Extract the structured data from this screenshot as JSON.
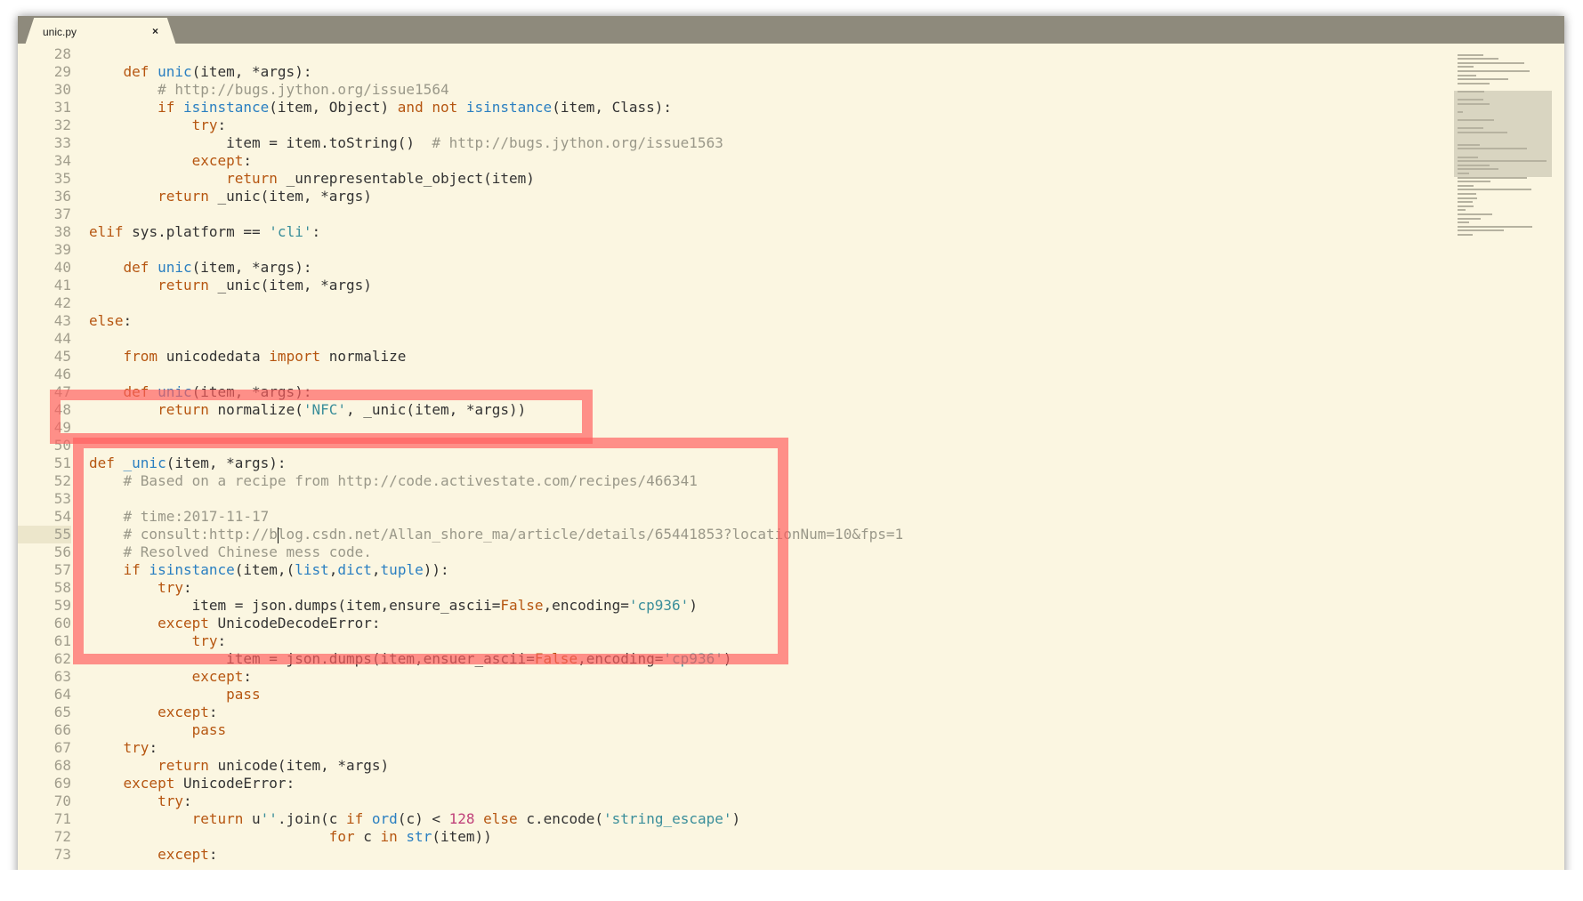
{
  "tab": {
    "title": "unic.py",
    "close_glyph": "×"
  },
  "editor": {
    "current_line": 55,
    "lines": [
      {
        "num": "28",
        "tokens": []
      },
      {
        "num": "29",
        "tokens": [
          [
            "",
            "    "
          ],
          [
            "kw",
            "def "
          ],
          [
            "fn",
            "unic"
          ],
          [
            "",
            "(item, *args):"
          ]
        ]
      },
      {
        "num": "30",
        "tokens": [
          [
            "",
            "        "
          ],
          [
            "cm",
            "# http://bugs.jython.org/issue1564"
          ]
        ]
      },
      {
        "num": "31",
        "tokens": [
          [
            "",
            "        "
          ],
          [
            "kw",
            "if "
          ],
          [
            "fn",
            "isinstance"
          ],
          [
            "",
            "(item, Object) "
          ],
          [
            "kw",
            "and not "
          ],
          [
            "fn",
            "isinstance"
          ],
          [
            "",
            "(item, Class):"
          ]
        ]
      },
      {
        "num": "32",
        "tokens": [
          [
            "",
            "            "
          ],
          [
            "kw",
            "try"
          ],
          [
            "",
            ":"
          ]
        ]
      },
      {
        "num": "33",
        "tokens": [
          [
            "",
            "                item = item.toString()  "
          ],
          [
            "cm",
            "# http://bugs.jython.org/issue1563"
          ]
        ]
      },
      {
        "num": "34",
        "tokens": [
          [
            "",
            "            "
          ],
          [
            "kw",
            "except"
          ],
          [
            "",
            ":"
          ]
        ]
      },
      {
        "num": "35",
        "tokens": [
          [
            "",
            "                "
          ],
          [
            "kw",
            "return "
          ],
          [
            "",
            "_unrepresentable_object(item)"
          ]
        ]
      },
      {
        "num": "36",
        "tokens": [
          [
            "",
            "        "
          ],
          [
            "kw",
            "return "
          ],
          [
            "",
            "_unic(item, *args)"
          ]
        ]
      },
      {
        "num": "37",
        "tokens": []
      },
      {
        "num": "38",
        "tokens": [
          [
            "kw",
            "elif "
          ],
          [
            "",
            "sys.platform == "
          ],
          [
            "st",
            "'cli'"
          ],
          [
            "",
            ":"
          ]
        ]
      },
      {
        "num": "39",
        "tokens": []
      },
      {
        "num": "40",
        "tokens": [
          [
            "",
            "    "
          ],
          [
            "kw",
            "def "
          ],
          [
            "fn",
            "unic"
          ],
          [
            "",
            "(item, *args):"
          ]
        ]
      },
      {
        "num": "41",
        "tokens": [
          [
            "",
            "        "
          ],
          [
            "kw",
            "return "
          ],
          [
            "",
            "_unic(item, *args)"
          ]
        ]
      },
      {
        "num": "42",
        "tokens": []
      },
      {
        "num": "43",
        "tokens": [
          [
            "kw",
            "else"
          ],
          [
            "",
            ":"
          ]
        ]
      },
      {
        "num": "44",
        "tokens": []
      },
      {
        "num": "45",
        "tokens": [
          [
            "",
            "    "
          ],
          [
            "kw",
            "from "
          ],
          [
            "",
            "unicodedata "
          ],
          [
            "kw",
            "import "
          ],
          [
            "",
            "normalize"
          ]
        ]
      },
      {
        "num": "46",
        "tokens": []
      },
      {
        "num": "47",
        "tokens": [
          [
            "",
            "    "
          ],
          [
            "kw",
            "def "
          ],
          [
            "fn",
            "unic"
          ],
          [
            "",
            "(item, *args):"
          ]
        ]
      },
      {
        "num": "48",
        "tokens": [
          [
            "",
            "        "
          ],
          [
            "kw",
            "return "
          ],
          [
            "",
            "normalize("
          ],
          [
            "st",
            "'NFC'"
          ],
          [
            "",
            ", _unic(item, *args))"
          ]
        ]
      },
      {
        "num": "49",
        "tokens": []
      },
      {
        "num": "50",
        "tokens": []
      },
      {
        "num": "51",
        "tokens": [
          [
            "kw",
            "def "
          ],
          [
            "fn",
            "_unic"
          ],
          [
            "",
            "(item, *args):"
          ]
        ]
      },
      {
        "num": "52",
        "tokens": [
          [
            "",
            "    "
          ],
          [
            "cm",
            "# Based on a recipe from http://code.activestate.com/recipes/466341"
          ]
        ]
      },
      {
        "num": "53",
        "tokens": []
      },
      {
        "num": "54",
        "tokens": [
          [
            "",
            "    "
          ],
          [
            "cm",
            "# time:2017-11-17"
          ]
        ]
      },
      {
        "num": "55",
        "tokens": [
          [
            "",
            "    "
          ],
          [
            "cm",
            "# consult:http://b"
          ],
          [
            "caret",
            ""
          ],
          [
            "cm",
            "log.csdn.net/Allan_shore_ma/article/details/65441853?locationNum=10&fps=1"
          ]
        ]
      },
      {
        "num": "56",
        "tokens": [
          [
            "",
            "    "
          ],
          [
            "cm",
            "# Resolved Chinese mess code."
          ]
        ]
      },
      {
        "num": "57",
        "tokens": [
          [
            "",
            "    "
          ],
          [
            "kw",
            "if "
          ],
          [
            "fn",
            "isinstance"
          ],
          [
            "",
            "(item,("
          ],
          [
            "fn",
            "list"
          ],
          [
            "",
            ","
          ],
          [
            "fn",
            "dict"
          ],
          [
            "",
            ","
          ],
          [
            "fn",
            "tuple"
          ],
          [
            "",
            ")):"
          ]
        ]
      },
      {
        "num": "58",
        "tokens": [
          [
            "",
            "        "
          ],
          [
            "kw",
            "try"
          ],
          [
            "",
            ":"
          ]
        ]
      },
      {
        "num": "59",
        "tokens": [
          [
            "",
            "            item = json.dumps(item,ensure_ascii="
          ],
          [
            "kw",
            "False"
          ],
          [
            "",
            ",encoding="
          ],
          [
            "st",
            "'cp936'"
          ],
          [
            "",
            ")"
          ]
        ]
      },
      {
        "num": "60",
        "tokens": [
          [
            "",
            "        "
          ],
          [
            "kw",
            "except "
          ],
          [
            "",
            "UnicodeDecodeError:"
          ]
        ]
      },
      {
        "num": "61",
        "tokens": [
          [
            "",
            "            "
          ],
          [
            "kw",
            "try"
          ],
          [
            "",
            ":"
          ]
        ]
      },
      {
        "num": "62",
        "tokens": [
          [
            "",
            "                item = json.dumps(item,ensuer_ascii="
          ],
          [
            "kw",
            "False"
          ],
          [
            "",
            ",encoding="
          ],
          [
            "st",
            "'cp936'"
          ],
          [
            "",
            ")"
          ]
        ]
      },
      {
        "num": "63",
        "tokens": [
          [
            "",
            "            "
          ],
          [
            "kw",
            "except"
          ],
          [
            "",
            ":"
          ]
        ]
      },
      {
        "num": "64",
        "tokens": [
          [
            "",
            "                "
          ],
          [
            "kw",
            "pass"
          ]
        ]
      },
      {
        "num": "65",
        "tokens": [
          [
            "",
            "        "
          ],
          [
            "kw",
            "except"
          ],
          [
            "",
            ":"
          ]
        ]
      },
      {
        "num": "66",
        "tokens": [
          [
            "",
            "            "
          ],
          [
            "kw",
            "pass"
          ]
        ]
      },
      {
        "num": "67",
        "tokens": [
          [
            "",
            "    "
          ],
          [
            "kw",
            "try"
          ],
          [
            "",
            ":"
          ]
        ]
      },
      {
        "num": "68",
        "tokens": [
          [
            "",
            "        "
          ],
          [
            "kw",
            "return "
          ],
          [
            "",
            "unicode(item, *args)"
          ]
        ]
      },
      {
        "num": "69",
        "tokens": [
          [
            "",
            "    "
          ],
          [
            "kw",
            "except "
          ],
          [
            "",
            "UnicodeError:"
          ]
        ]
      },
      {
        "num": "70",
        "tokens": [
          [
            "",
            "        "
          ],
          [
            "kw",
            "try"
          ],
          [
            "",
            ":"
          ]
        ]
      },
      {
        "num": "71",
        "tokens": [
          [
            "",
            "            "
          ],
          [
            "kw",
            "return "
          ],
          [
            "",
            "u"
          ],
          [
            "st",
            "''"
          ],
          [
            "",
            ".join(c "
          ],
          [
            "kw",
            "if "
          ],
          [
            "fn",
            "ord"
          ],
          [
            "",
            "(c) < "
          ],
          [
            "cn",
            "128"
          ],
          [
            "",
            " "
          ],
          [
            "kw",
            "else "
          ],
          [
            "",
            "c.encode("
          ],
          [
            "st",
            "'string_escape'"
          ],
          [
            "",
            ")"
          ]
        ]
      },
      {
        "num": "72",
        "tokens": [
          [
            "",
            "                            "
          ],
          [
            "kw",
            "for "
          ],
          [
            "",
            "c "
          ],
          [
            "kw",
            "in "
          ],
          [
            "fn",
            "str"
          ],
          [
            "",
            "(item))"
          ]
        ]
      },
      {
        "num": "73",
        "tokens": [
          [
            "",
            "        "
          ],
          [
            "kw",
            "except"
          ],
          [
            "",
            ":"
          ]
        ]
      }
    ]
  },
  "colors": {
    "background": "#fbf6e1",
    "keyword": "#b65611",
    "function": "#2a7fc1",
    "comment": "#9a9889",
    "string": "#3a8e9a",
    "number": "#c0417a",
    "highlight": "#ff5f5f"
  },
  "icons": {
    "tab_close": "close-icon"
  }
}
